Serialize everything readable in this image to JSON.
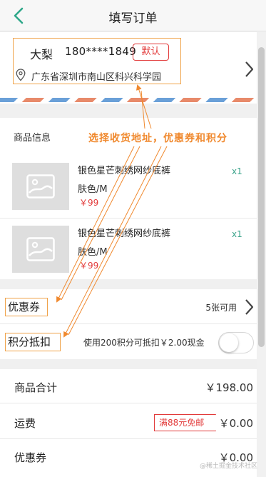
{
  "header": {
    "title": "填写订单"
  },
  "address": {
    "name": "大梨",
    "phone": "180****1849",
    "default_label": "默认",
    "full_address": "广东省深圳市南山区科兴科学园"
  },
  "goods": {
    "section_title": "商品信息",
    "items": [
      {
        "name": "银色星芒刺绣网纱底裤",
        "spec": "肤色/M",
        "price": "￥99",
        "qty": "x1"
      },
      {
        "name": "银色星芒刺绣网纱底裤",
        "spec": "肤色/M",
        "price": "￥99",
        "qty": "x1"
      }
    ]
  },
  "annotation": {
    "text": "选择收货地址，优惠券和积分"
  },
  "promotions": {
    "coupon_label": "优惠券",
    "coupon_count": "5张可用",
    "points_label": "积分抵扣",
    "points_text": "使用200积分可抵扣￥2.00现金"
  },
  "summary": {
    "goods_total_label": "商品合计",
    "goods_total_value": "￥198.00",
    "shipping_label": "运费",
    "shipping_tag": "满88元免邮",
    "shipping_value": "￥0.00",
    "coupon_label": "优惠券",
    "coupon_value": "￥0.00"
  },
  "watermark": "@稀土掘金技术社区",
  "colors": {
    "accent_green": "#3aa38a",
    "price_red": "#e23a3a",
    "annotation_orange": "#f0892e"
  }
}
